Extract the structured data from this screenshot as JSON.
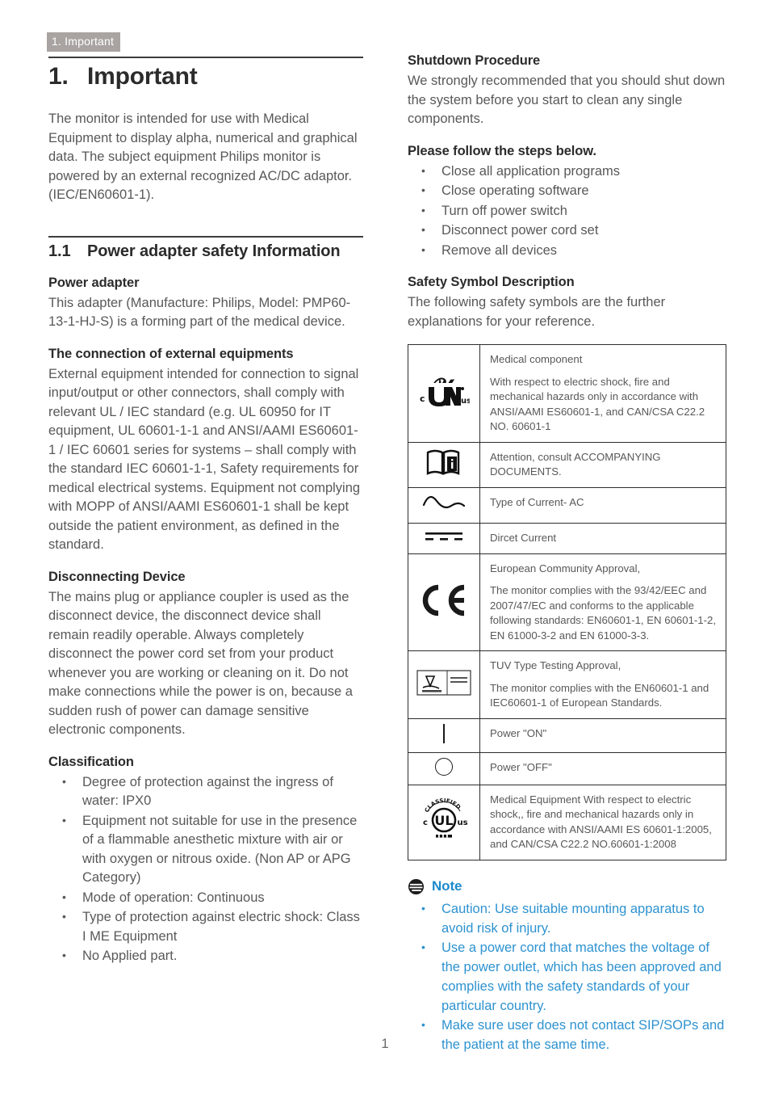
{
  "header": {
    "tag": "1. Important"
  },
  "folio": {
    "page_number": "1"
  },
  "left_column": {
    "chapter": {
      "number": "1.",
      "title": "Important"
    },
    "intro": "The monitor is intended for use with Medical Equipment to display alpha, numerical and graphical data. The subject equipment Philips monitor is powered by an external recognized AC/DC adaptor. (IEC/EN60601-1).",
    "section": {
      "number": "1.1",
      "title": "Power adapter safety Information"
    },
    "power_adapter": {
      "heading": "Power adapter",
      "text": "This adapter (Manufacture: Philips, Model: PMP60-13-1-HJ-S) is a forming part of the medical device."
    },
    "external_equipment": {
      "heading": "The connection of external equipments",
      "text": "External equipment intended for connection to signal input/output or other connectors, shall comply with relevant UL / IEC standard (e.g. UL 60950 for IT equipment, UL 60601-1-1 and ANSI/AAMI ES60601-1 / IEC 60601 series for systems – shall comply with the standard IEC 60601-1-1, Safety requirements for medical electrical systems. Equipment not complying with MOPP of ANSI/AAMI ES60601-1 shall be kept outside the patient environment, as defined in the standard."
    },
    "disconnecting_device": {
      "heading": "Disconnecting Device",
      "text": "The mains plug or appliance coupler is used as the disconnect device, the disconnect device shall remain readily operable. Always completely disconnect the power cord set from your product whenever you are working or cleaning on it. Do not make connections while the power is on, because a sudden rush of power can damage sensitive electronic components."
    },
    "classification": {
      "heading": "Classification",
      "items": [
        "Degree of protection against the ingress of water: IPX0",
        "Equipment not suitable for use in the presence of a flammable anesthetic mixture with air or with oxygen or nitrous oxide. (Non AP or APG Category)",
        "Mode of operation: Continuous",
        "Type of protection against electric shock: Class I ME Equipment",
        "No Applied part."
      ]
    }
  },
  "right_column": {
    "shutdown": {
      "heading": "Shutdown Procedure",
      "text": "We strongly recommended that you should shut down the system before you start to clean any single components."
    },
    "steps": {
      "heading": "Please follow the steps below.",
      "items": [
        "Close all application programs",
        "Close operating software",
        "Turn off power switch",
        "Disconnect power cord set",
        "Remove all devices"
      ]
    },
    "safety_symbols": {
      "heading": "Safety Symbol Description",
      "intro": "The following safety symbols are the further explanations for your reference.",
      "rows": [
        {
          "symbol_name": "cul-us-mark-icon",
          "symbol_text": "c ™ us",
          "lines": [
            "Medical component",
            "With respect to electric shock, fire and mechanical hazards only in accordance with ANSI/AAMI ES60601-1, and CAN/CSA C22.2 NO. 60601-1"
          ]
        },
        {
          "symbol_name": "consult-documents-icon",
          "symbol_text": "",
          "lines": [
            "Attention, consult ACCOMPANYING DOCUMENTS."
          ]
        },
        {
          "symbol_name": "alternating-current-icon",
          "symbol_text": "",
          "lines": [
            "Type of Current- AC"
          ]
        },
        {
          "symbol_name": "direct-current-icon",
          "symbol_text": "",
          "lines": [
            "Dircet Current"
          ]
        },
        {
          "symbol_name": "ce-mark-icon",
          "symbol_text": "CƊ",
          "lines": [
            "European Community Approval,",
            "The monitor complies with the 93/42/EEC and 2007/47/EC and conforms to the applicable following standards: EN60601-1, EN 60601-1-2, EN 61000-3-2 and EN 61000-3-3."
          ]
        },
        {
          "symbol_name": "tuv-rheinland-mark-icon",
          "symbol_text": "",
          "lines": [
            "TUV Type Testing Approval,",
            "The monitor complies with the EN60601-1 and IEC60601-1 of European Standards."
          ]
        },
        {
          "symbol_name": "power-on-icon",
          "symbol_text": "",
          "lines": [
            "Power \"ON\""
          ]
        },
        {
          "symbol_name": "power-off-icon",
          "symbol_text": "",
          "lines": [
            "Power \"OFF\""
          ]
        },
        {
          "symbol_name": "ul-classified-mark-icon",
          "symbol_text": "",
          "lines": [
            "Medical Equipment With respect to electric shock,, fire and mechanical hazards only in accordance with ANSI/AAMI ES 60601-1:2005, and CAN/CSA C22.2 NO.60601-1:2008"
          ]
        }
      ]
    },
    "note": {
      "title": "Note",
      "icon": "note-bubble-icon",
      "color": "#2d92d0",
      "items": [
        "Caution: Use suitable mounting apparatus to avoid risk of injury.",
        "Use a power cord that matches the voltage of the power outlet, which has been approved and complies with the safety standards of your particular country.",
        "Make sure user does not contact SIP/SOPs and the patient at the same time."
      ]
    }
  }
}
